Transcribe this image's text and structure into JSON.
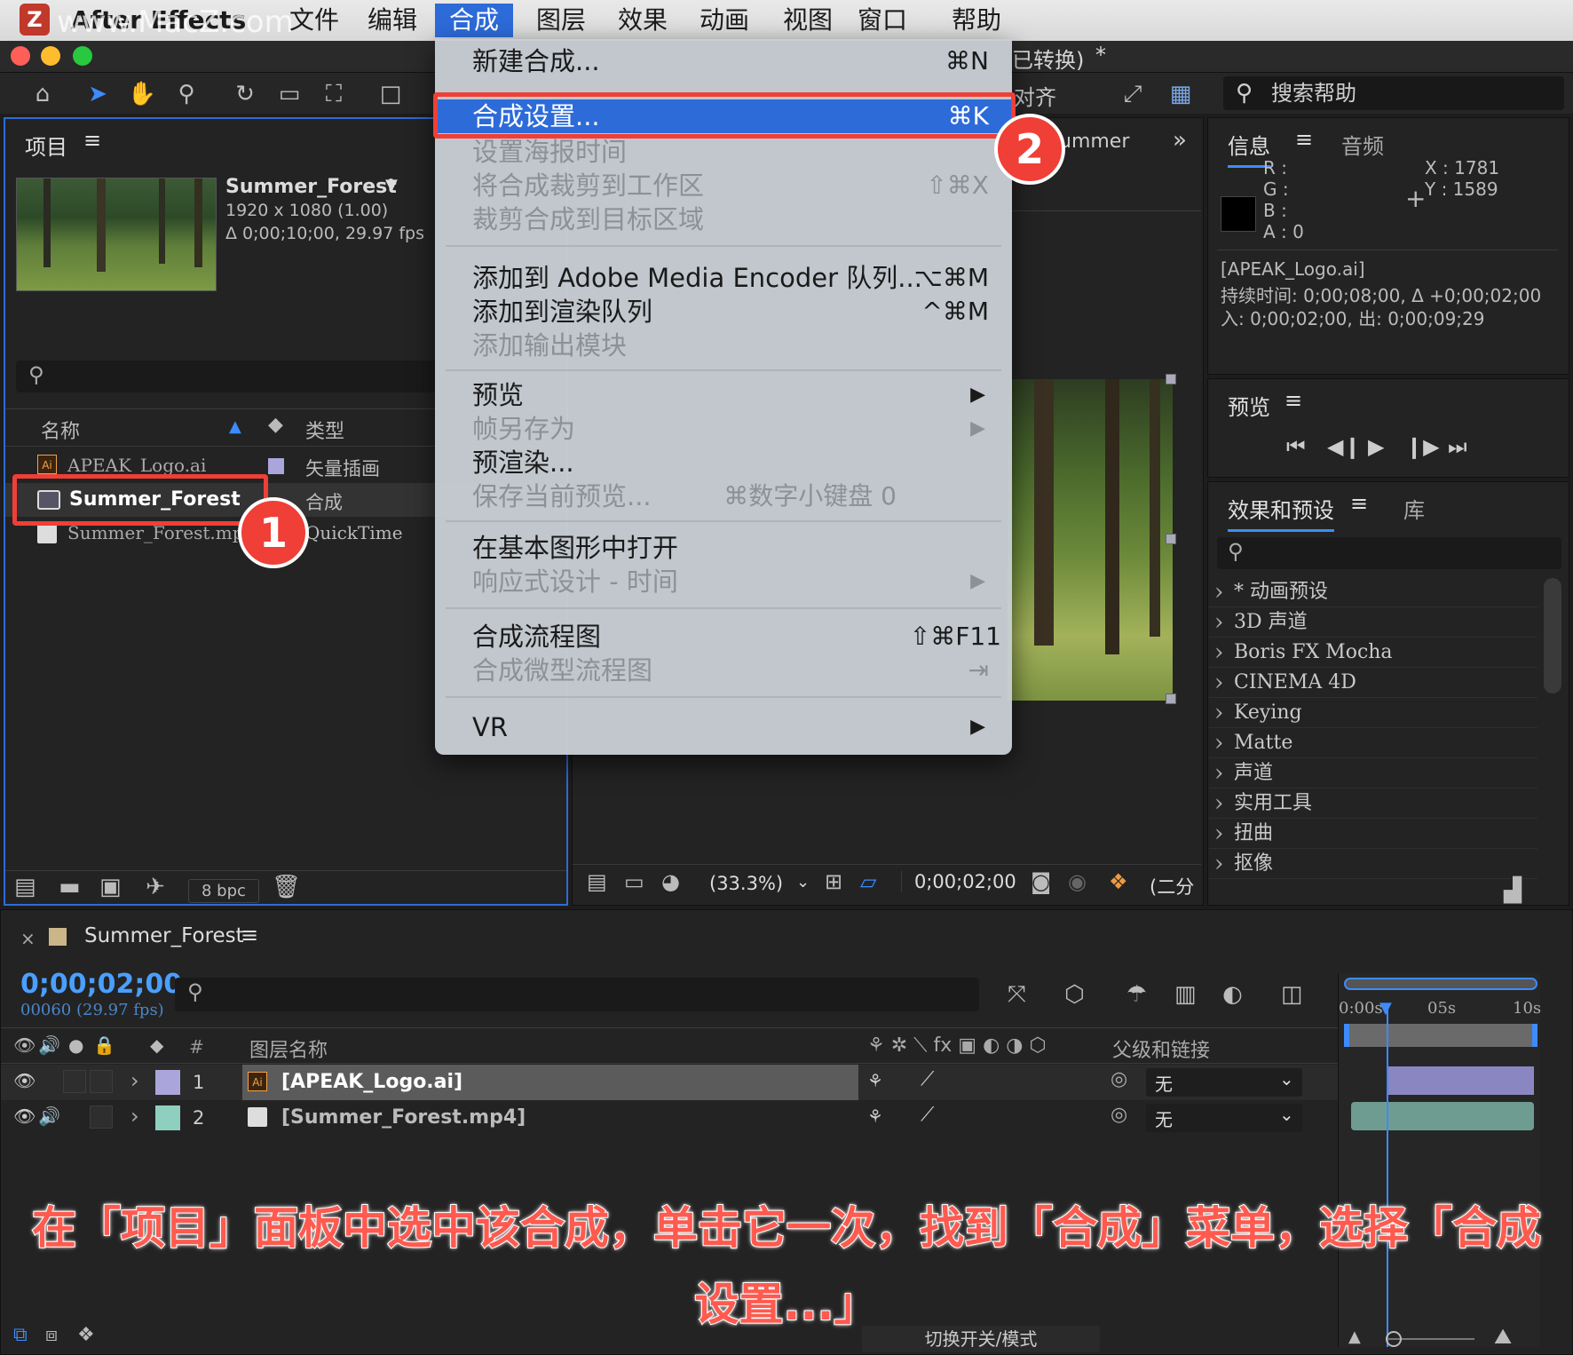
{
  "colors": {
    "accent": "#2d6bd9",
    "callout": "#ef3f36",
    "timecode": "#4a9fff"
  },
  "menubar": {
    "app": "After Effects",
    "watermark": "www.MacZ.com",
    "items": [
      "文件",
      "编辑",
      "合成",
      "图层",
      "效果",
      "动画",
      "视图",
      "窗口",
      "帮助"
    ]
  },
  "titlebar": {
    "suffix": "已转换)",
    "star": "*"
  },
  "toolbar": {
    "align": "对齐",
    "search_help": "搜索帮助"
  },
  "project": {
    "title": "项目",
    "comp_name": "Summer_Forest",
    "comp_res": "1920 x 1080 (1.00)",
    "comp_dur": "Δ 0;00;10;00, 29.97 fps",
    "col_name": "名称",
    "col_type": "类型",
    "items": [
      {
        "name": "APEAK_Logo.ai",
        "type": "矢量插画",
        "icon": "ai-file-icon"
      },
      {
        "name": "Summer_Forest",
        "type": "合成",
        "icon": "composition-icon"
      },
      {
        "name": "Summer_Forest.mp4",
        "type": "QuickTime",
        "icon": "video-file-icon"
      }
    ],
    "bpc": "8 bpc"
  },
  "viewer": {
    "tab": "ummer",
    "zoom": "(33.3%)",
    "timecode": "0;00;02;00",
    "quality": "(二分"
  },
  "info": {
    "tab1": "信息",
    "tab2": "音频",
    "r": "R :",
    "g": "G :",
    "b": "B :",
    "a": "A : 0",
    "x": "X : 1781",
    "y": "Y : 1589",
    "layer": "[APEAK_Logo.ai]",
    "duration": "持续时间: 0;00;08;00, Δ +0;00;02;00",
    "inout": "入: 0;00;02;00,  出: 0;00;09;29"
  },
  "preview": {
    "title": "预览"
  },
  "effects": {
    "tab1": "效果和预设",
    "tab2": "库",
    "items": [
      "* 动画预设",
      "3D 声道",
      "Boris FX Mocha",
      "CINEMA 4D",
      "Keying",
      "Matte",
      "声道",
      "实用工具",
      "扭曲",
      "抠像"
    ]
  },
  "menu": {
    "items": [
      {
        "label": "新建合成...",
        "shortcut": "⌘N",
        "disabled": false
      },
      {
        "label": "合成设置...",
        "shortcut": "⌘K",
        "disabled": false,
        "highlighted": true
      },
      {
        "label": "设置海报时间",
        "shortcut": "",
        "disabled": true
      },
      {
        "label": "将合成裁剪到工作区",
        "shortcut": "⇧⌘X",
        "disabled": true
      },
      {
        "label": "裁剪合成到目标区域",
        "shortcut": "",
        "disabled": true
      },
      {
        "label": "添加到 Adobe Media Encoder 队列...",
        "shortcut": "⌥⌘M",
        "disabled": false
      },
      {
        "label": "添加到渲染队列",
        "shortcut": "^⌘M",
        "disabled": false
      },
      {
        "label": "添加输出模块",
        "shortcut": "",
        "disabled": true
      },
      {
        "label": "预览",
        "shortcut": "▶",
        "disabled": false
      },
      {
        "label": "帧另存为",
        "shortcut": "▶",
        "disabled": true
      },
      {
        "label": "预渲染...",
        "shortcut": "",
        "disabled": false
      },
      {
        "label": "保存当前预览...",
        "shortcut": "⌘数字小键盘 0",
        "disabled": true
      },
      {
        "label": "在基本图形中打开",
        "shortcut": "",
        "disabled": false
      },
      {
        "label": "响应式设计 - 时间",
        "shortcut": "▶",
        "disabled": true
      },
      {
        "label": "合成流程图",
        "shortcut": "⇧⌘F11",
        "disabled": false
      },
      {
        "label": "合成微型流程图",
        "shortcut": "⇥",
        "disabled": true
      },
      {
        "label": "VR",
        "shortcut": "▶",
        "disabled": false
      }
    ]
  },
  "timeline": {
    "tab": "Summer_Forest",
    "timecode": "0;00;02;00",
    "frames": "00060 (29.97 fps)",
    "col_num": "#",
    "col_layer": "图层名称",
    "col_parent": "父级和链接",
    "ruler": [
      "0:00s",
      "05s",
      "10s"
    ],
    "layers": [
      {
        "num": "1",
        "name": "[APEAK_Logo.ai]",
        "parent": "无"
      },
      {
        "num": "2",
        "name": "[Summer_Forest.mp4]",
        "parent": "无"
      }
    ],
    "toggle_modes": "切换开关/模式"
  },
  "callouts": {
    "one": "1",
    "two": "2"
  },
  "caption": "在「项目」面板中选中该合成，单击它一次，找到「合成」菜单，选择「合成设置...」"
}
